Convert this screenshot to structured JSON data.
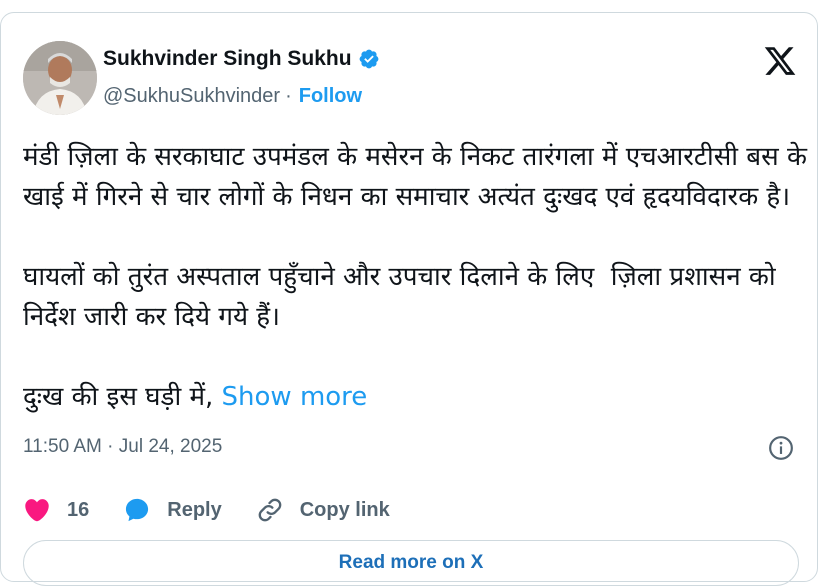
{
  "author": {
    "display_name": "Sukhvinder Singh Sukhu",
    "handle": "@SukhuSukhvinder",
    "separator": "·",
    "follow_label": "Follow"
  },
  "tweet": {
    "text": "मंडी ज़िला के सरकाघाट उपमंडल के मसेरन के निकट तारंगला में एचआरटीसी बस के खाई में गिरने से चार लोगों के निधन का समाचार अत्यंत दुःखद एवं हृदयविदारक है।\n\nघायलों को तुरंत अस्पताल पहुँचाने और उपचार दिलाने के लिए  ज़िला प्रशासन को निर्देश जारी कर दिये गये हैं।\n\nदुःख की इस घड़ी में, ",
    "show_more_label": "Show more",
    "timestamp": "11:50 AM · Jul 24, 2025"
  },
  "actions": {
    "like_count": "16",
    "reply_label": "Reply",
    "copy_link_label": "Copy link"
  },
  "footer": {
    "read_more_label": "Read more on X"
  },
  "colors": {
    "accent": "#1d9bf0",
    "like": "#f91880",
    "secondary_text": "#536471",
    "border": "#cfd9de"
  },
  "icons": {
    "verified": "verified-badge-icon",
    "logo": "x-logo-icon",
    "info": "info-icon",
    "like": "heart-icon",
    "reply": "speech-bubble-icon",
    "copy_link": "link-icon"
  }
}
